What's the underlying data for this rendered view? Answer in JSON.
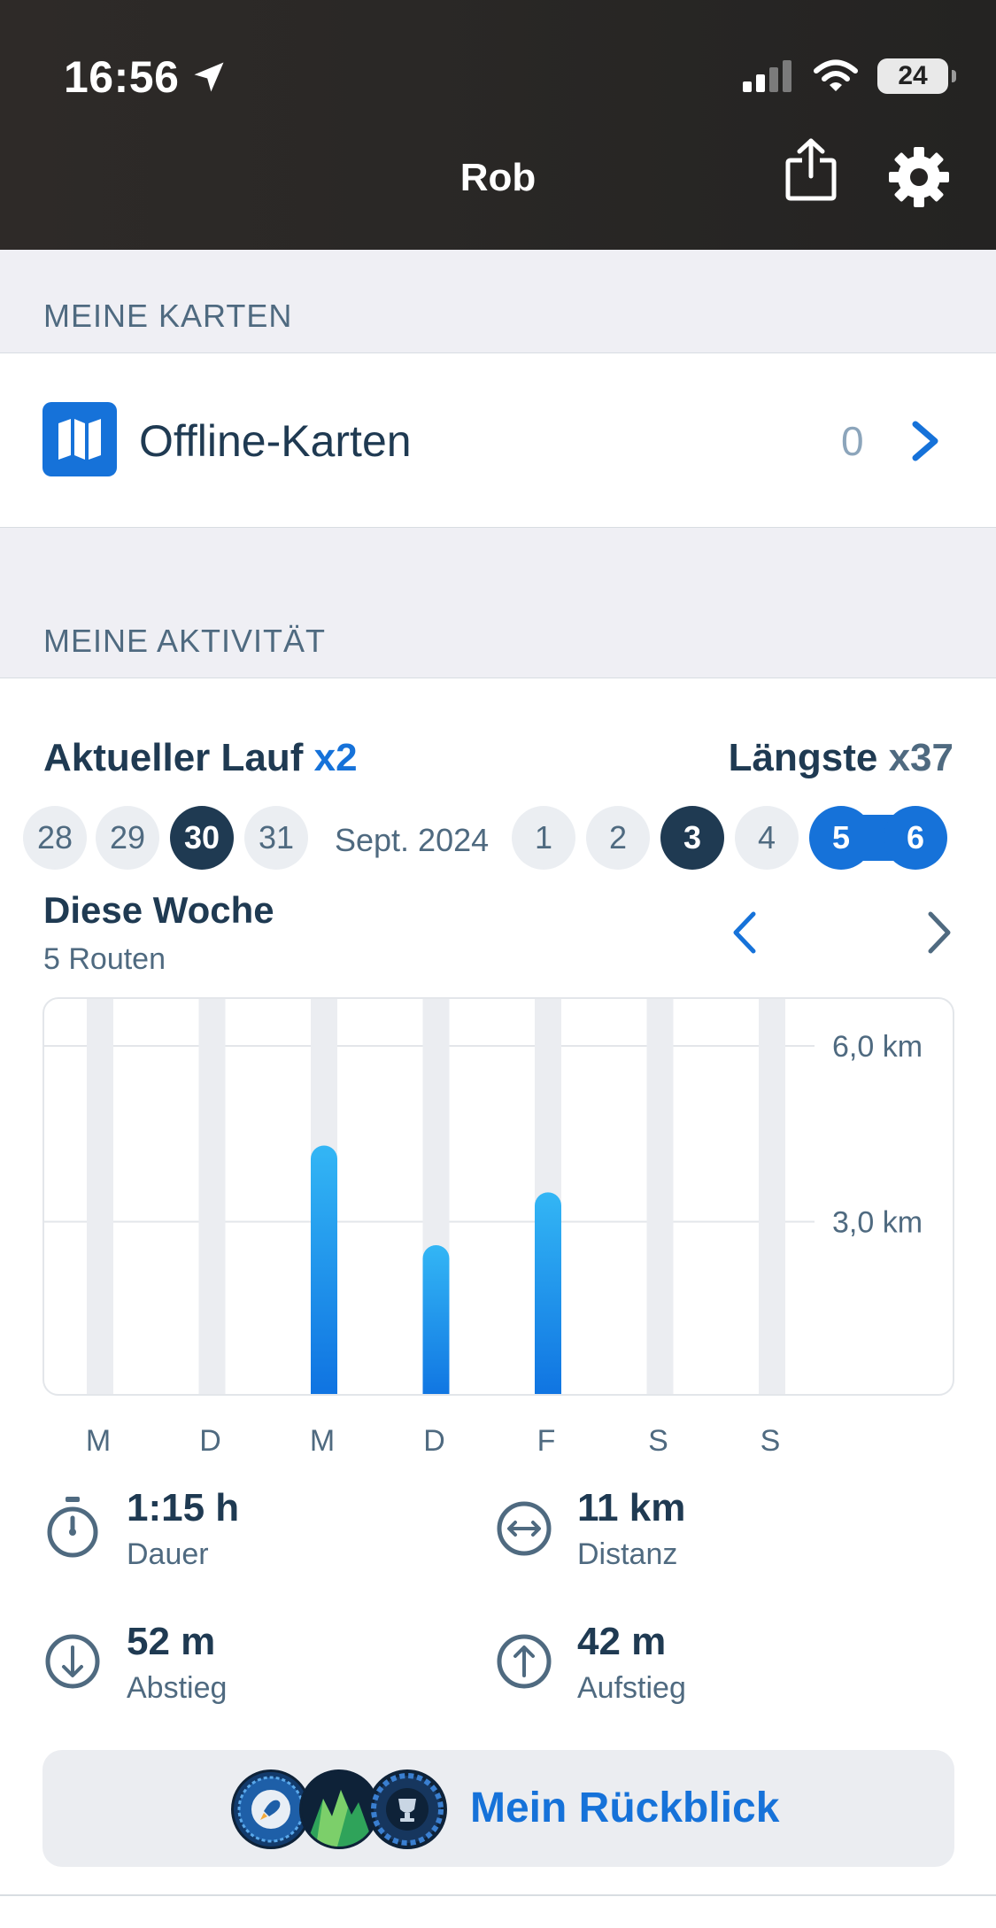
{
  "status_bar": {
    "time": "16:56",
    "battery": "24"
  },
  "header": {
    "title": "Rob"
  },
  "maps_section": {
    "label": "MEINE KARTEN",
    "offline_maps": {
      "label": "Offline-Karten",
      "count": "0"
    }
  },
  "activity_section": {
    "label": "MEINE AKTIVITÄT",
    "current_streak": {
      "label": "Aktueller Lauf",
      "value": "x2"
    },
    "longest_streak": {
      "label": "Längste",
      "value": "x37"
    },
    "days": [
      "28",
      "29",
      "30",
      "31",
      "1",
      "2",
      "3",
      "4",
      "5",
      "6"
    ],
    "month": "Sept. 2024",
    "week_title": "Diese Woche",
    "week_routes": "5 Routen"
  },
  "chart_data": {
    "type": "bar",
    "categories": [
      "M",
      "D",
      "M",
      "D",
      "F",
      "S",
      "S"
    ],
    "values": [
      0,
      0,
      4.3,
      2.6,
      3.5,
      0,
      0
    ],
    "y_ticks": [
      "6,0 km",
      "3,0 km"
    ],
    "ylim": [
      0,
      6.8
    ],
    "colors": {
      "bar_top": "#33b6f5",
      "bar_bottom": "#0d6fe0",
      "track": "#ebedf1"
    }
  },
  "stats": [
    {
      "value": "1:15 h",
      "label": "Dauer",
      "icon": "stopwatch-icon"
    },
    {
      "value": "11 km",
      "label": "Distanz",
      "icon": "distance-icon"
    },
    {
      "value": "52 m",
      "label": "Abstieg",
      "icon": "descent-icon"
    },
    {
      "value": "42 m",
      "label": "Aufstieg",
      "icon": "ascent-icon"
    }
  ],
  "review": {
    "label": "Mein Rückblick"
  },
  "colors": {
    "accent": "#1672d9",
    "dark": "#1f3a52",
    "muted": "#4f6a80"
  }
}
